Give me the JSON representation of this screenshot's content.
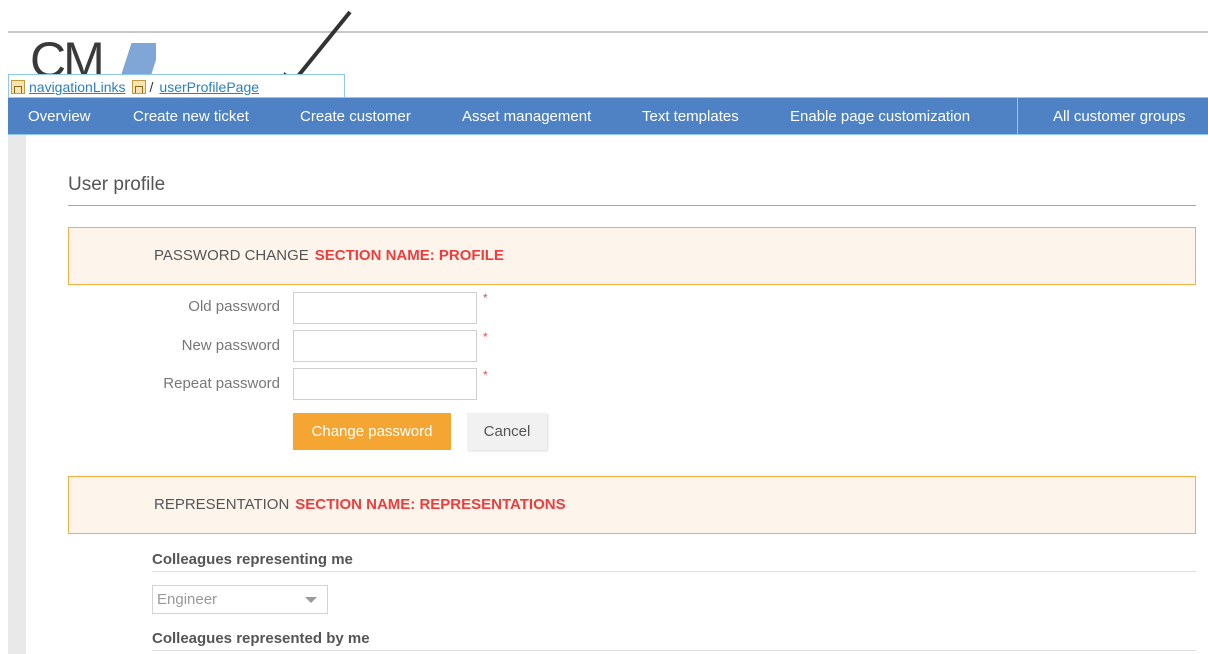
{
  "logo": {
    "text": "CM"
  },
  "breadcrumb": {
    "items": [
      {
        "label": "navigationLinks",
        "icon": "sitemap-icon"
      },
      {
        "label": "userProfilePage",
        "icon": "sitemap-icon"
      }
    ],
    "separator": "/"
  },
  "nav": {
    "items": [
      {
        "label": "Overview"
      },
      {
        "label": "Create new ticket"
      },
      {
        "label": "Create customer"
      },
      {
        "label": "Asset management"
      },
      {
        "label": "Text templates"
      },
      {
        "label": "Enable page customization"
      },
      {
        "label": "All customer groups"
      }
    ]
  },
  "page": {
    "title": "User profile"
  },
  "password_section": {
    "title": "PASSWORD CHANGE",
    "section_name": "SECTION NAME: PROFILE",
    "fields": [
      {
        "label": "Old password",
        "value": "",
        "required_mark": "*"
      },
      {
        "label": "New password",
        "value": "",
        "required_mark": "*"
      },
      {
        "label": "Repeat password",
        "value": "",
        "required_mark": "*"
      }
    ],
    "submit_label": "Change password",
    "cancel_label": "Cancel"
  },
  "representation_section": {
    "title": "REPRESENTATION",
    "section_name": "SECTION NAME: REPRESENTATIONS",
    "representing_me_heading": "Colleagues representing me",
    "representing_me_select": "Engineer",
    "represented_by_me_heading": "Colleagues represented by me"
  },
  "colors": {
    "nav_bg": "#4f82c4",
    "accent": "#f5a531",
    "section_border": "#f5ad45",
    "section_bg": "#fdf5ec",
    "section_name": "#f03c3c",
    "link": "#2a7fc0"
  }
}
